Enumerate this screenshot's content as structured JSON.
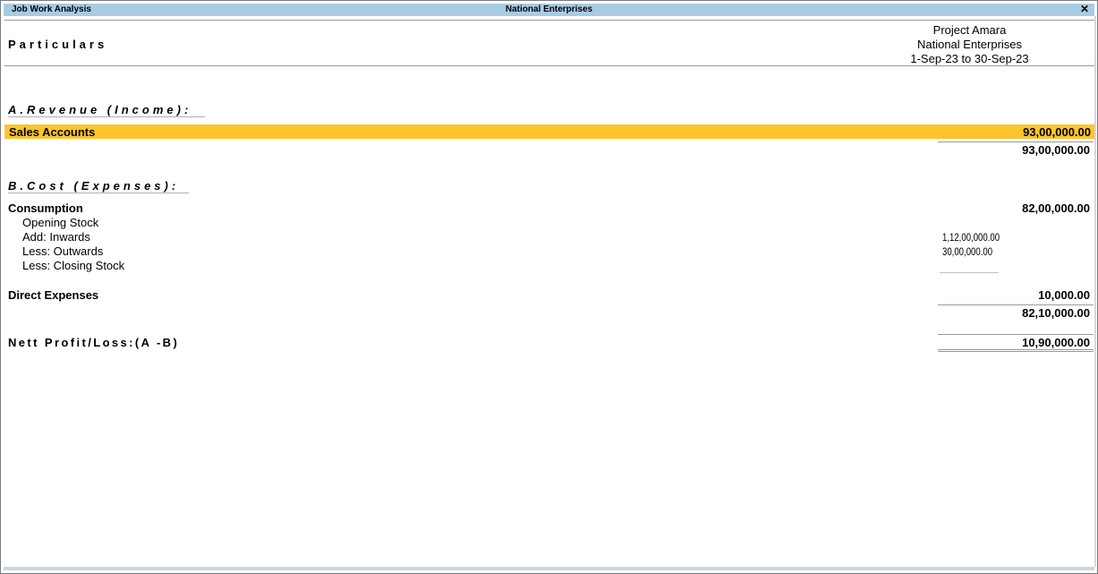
{
  "window": {
    "left_title": "Job Work Analysis",
    "center_title": "National Enterprises",
    "close_glyph": "✕"
  },
  "header": {
    "particulars": "Particulars",
    "column": {
      "project": "Project Amara",
      "company": "National Enterprises",
      "period": "1-Sep-23 to 30-Sep-23"
    }
  },
  "revenue": {
    "heading": "A.Revenue (Income):",
    "rows": [
      {
        "label": "Sales Accounts",
        "amount": "93,00,000.00"
      }
    ],
    "total": "93,00,000.00"
  },
  "cost": {
    "heading": "B.Cost (Expenses):",
    "consumption": {
      "label": "Consumption",
      "amount": "82,00,000.00",
      "details": [
        {
          "label": "Opening Stock",
          "amount": ""
        },
        {
          "label": "Add: Inwards",
          "amount": "1,12,00,000.00"
        },
        {
          "label": "Less: Outwards",
          "amount": "30,00,000.00"
        },
        {
          "label": "Less: Closing Stock",
          "amount": ""
        }
      ]
    },
    "direct_expenses": {
      "label": "Direct Expenses",
      "amount": "10,000.00"
    },
    "total": "82,10,000.00"
  },
  "net": {
    "label": "Nett Profit/Loss:(A -B)",
    "amount": "10,90,000.00"
  },
  "colors": {
    "titlebar": "#a8cbe3",
    "highlight": "#fdc42c"
  }
}
